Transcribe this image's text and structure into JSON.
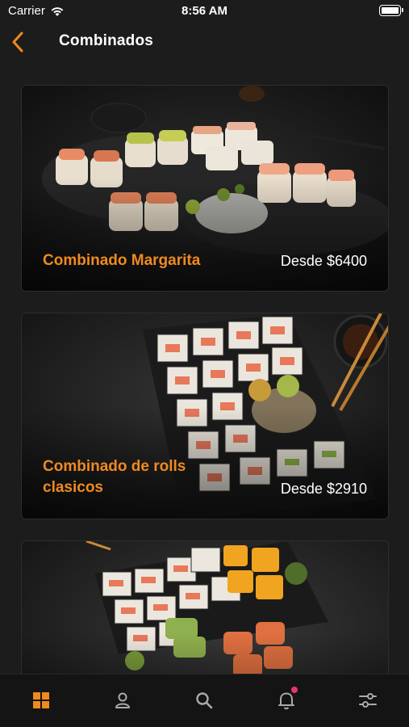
{
  "status": {
    "carrier": "Carrier",
    "time": "8:56 AM"
  },
  "header": {
    "title": "Combinados"
  },
  "cards": [
    {
      "name": "Combinado Margarita",
      "price": "Desde $6400"
    },
    {
      "name": "Combinado de rolls clasicos",
      "price": "Desde $2910"
    },
    {
      "name": "",
      "price": ""
    }
  ],
  "tabs": [
    "grid-icon",
    "profile-icon",
    "search-icon",
    "bell-icon",
    "filters-icon"
  ],
  "colors": {
    "accent": "#f08a1f",
    "notification": "#e8336b",
    "background": "#1c1c1c"
  }
}
